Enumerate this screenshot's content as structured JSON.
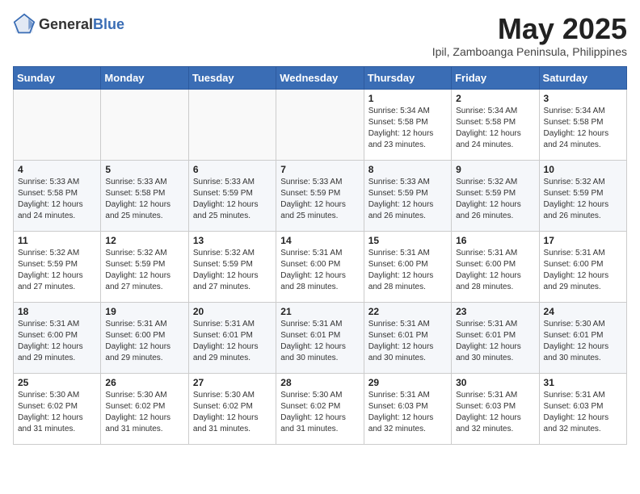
{
  "header": {
    "logo_general": "General",
    "logo_blue": "Blue",
    "month_title": "May 2025",
    "subtitle": "Ipil, Zamboanga Peninsula, Philippines"
  },
  "days_of_week": [
    "Sunday",
    "Monday",
    "Tuesday",
    "Wednesday",
    "Thursday",
    "Friday",
    "Saturday"
  ],
  "weeks": [
    [
      {
        "day": "",
        "content": ""
      },
      {
        "day": "",
        "content": ""
      },
      {
        "day": "",
        "content": ""
      },
      {
        "day": "",
        "content": ""
      },
      {
        "day": "1",
        "content": "Sunrise: 5:34 AM\nSunset: 5:58 PM\nDaylight: 12 hours\nand 23 minutes."
      },
      {
        "day": "2",
        "content": "Sunrise: 5:34 AM\nSunset: 5:58 PM\nDaylight: 12 hours\nand 24 minutes."
      },
      {
        "day": "3",
        "content": "Sunrise: 5:34 AM\nSunset: 5:58 PM\nDaylight: 12 hours\nand 24 minutes."
      }
    ],
    [
      {
        "day": "4",
        "content": "Sunrise: 5:33 AM\nSunset: 5:58 PM\nDaylight: 12 hours\nand 24 minutes."
      },
      {
        "day": "5",
        "content": "Sunrise: 5:33 AM\nSunset: 5:58 PM\nDaylight: 12 hours\nand 25 minutes."
      },
      {
        "day": "6",
        "content": "Sunrise: 5:33 AM\nSunset: 5:59 PM\nDaylight: 12 hours\nand 25 minutes."
      },
      {
        "day": "7",
        "content": "Sunrise: 5:33 AM\nSunset: 5:59 PM\nDaylight: 12 hours\nand 25 minutes."
      },
      {
        "day": "8",
        "content": "Sunrise: 5:33 AM\nSunset: 5:59 PM\nDaylight: 12 hours\nand 26 minutes."
      },
      {
        "day": "9",
        "content": "Sunrise: 5:32 AM\nSunset: 5:59 PM\nDaylight: 12 hours\nand 26 minutes."
      },
      {
        "day": "10",
        "content": "Sunrise: 5:32 AM\nSunset: 5:59 PM\nDaylight: 12 hours\nand 26 minutes."
      }
    ],
    [
      {
        "day": "11",
        "content": "Sunrise: 5:32 AM\nSunset: 5:59 PM\nDaylight: 12 hours\nand 27 minutes."
      },
      {
        "day": "12",
        "content": "Sunrise: 5:32 AM\nSunset: 5:59 PM\nDaylight: 12 hours\nand 27 minutes."
      },
      {
        "day": "13",
        "content": "Sunrise: 5:32 AM\nSunset: 5:59 PM\nDaylight: 12 hours\nand 27 minutes."
      },
      {
        "day": "14",
        "content": "Sunrise: 5:31 AM\nSunset: 6:00 PM\nDaylight: 12 hours\nand 28 minutes."
      },
      {
        "day": "15",
        "content": "Sunrise: 5:31 AM\nSunset: 6:00 PM\nDaylight: 12 hours\nand 28 minutes."
      },
      {
        "day": "16",
        "content": "Sunrise: 5:31 AM\nSunset: 6:00 PM\nDaylight: 12 hours\nand 28 minutes."
      },
      {
        "day": "17",
        "content": "Sunrise: 5:31 AM\nSunset: 6:00 PM\nDaylight: 12 hours\nand 29 minutes."
      }
    ],
    [
      {
        "day": "18",
        "content": "Sunrise: 5:31 AM\nSunset: 6:00 PM\nDaylight: 12 hours\nand 29 minutes."
      },
      {
        "day": "19",
        "content": "Sunrise: 5:31 AM\nSunset: 6:00 PM\nDaylight: 12 hours\nand 29 minutes."
      },
      {
        "day": "20",
        "content": "Sunrise: 5:31 AM\nSunset: 6:01 PM\nDaylight: 12 hours\nand 29 minutes."
      },
      {
        "day": "21",
        "content": "Sunrise: 5:31 AM\nSunset: 6:01 PM\nDaylight: 12 hours\nand 30 minutes."
      },
      {
        "day": "22",
        "content": "Sunrise: 5:31 AM\nSunset: 6:01 PM\nDaylight: 12 hours\nand 30 minutes."
      },
      {
        "day": "23",
        "content": "Sunrise: 5:31 AM\nSunset: 6:01 PM\nDaylight: 12 hours\nand 30 minutes."
      },
      {
        "day": "24",
        "content": "Sunrise: 5:30 AM\nSunset: 6:01 PM\nDaylight: 12 hours\nand 30 minutes."
      }
    ],
    [
      {
        "day": "25",
        "content": "Sunrise: 5:30 AM\nSunset: 6:02 PM\nDaylight: 12 hours\nand 31 minutes."
      },
      {
        "day": "26",
        "content": "Sunrise: 5:30 AM\nSunset: 6:02 PM\nDaylight: 12 hours\nand 31 minutes."
      },
      {
        "day": "27",
        "content": "Sunrise: 5:30 AM\nSunset: 6:02 PM\nDaylight: 12 hours\nand 31 minutes."
      },
      {
        "day": "28",
        "content": "Sunrise: 5:30 AM\nSunset: 6:02 PM\nDaylight: 12 hours\nand 31 minutes."
      },
      {
        "day": "29",
        "content": "Sunrise: 5:31 AM\nSunset: 6:03 PM\nDaylight: 12 hours\nand 32 minutes."
      },
      {
        "day": "30",
        "content": "Sunrise: 5:31 AM\nSunset: 6:03 PM\nDaylight: 12 hours\nand 32 minutes."
      },
      {
        "day": "31",
        "content": "Sunrise: 5:31 AM\nSunset: 6:03 PM\nDaylight: 12 hours\nand 32 minutes."
      }
    ]
  ]
}
